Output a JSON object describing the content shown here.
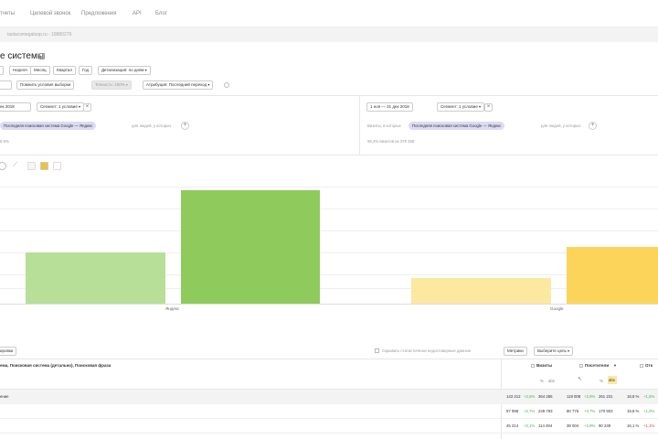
{
  "nav": {
    "items": [
      "тчеты",
      "Целевой звонок",
      "Предложения",
      "API",
      "Блог"
    ]
  },
  "breadcrumb": "tastacsmegaloop.ru - 18880279",
  "page": {
    "title": "е системы"
  },
  "toolbar": {
    "period_buttons": [
      "",
      "Неделя",
      "Месяц",
      "Квартал",
      "Год"
    ],
    "detail": "Детализация: по дням",
    "row2": [
      "",
      "Помнить условия выборки",
      "Точность: 100%",
      "Атрибуция: Последний переход"
    ]
  },
  "segments": {
    "left": {
      "date": "ек 2018",
      "filter": "Сегмент: 1 условие",
      "tag": "Последняя поисковая система Google — Яндекс",
      "more": "для людей, у которых",
      "visits": "8.9%"
    },
    "right": {
      "date": "1 ноя — 31 дек 2018",
      "filter": "Сегмент: 1 условие",
      "prefix": "Визиты, в которых",
      "tag": "Последняя поисковая система Google — Яндекс",
      "more": "для людей, у которых",
      "visits": "98,4% визитов из 378 285"
    }
  },
  "chart_data": {
    "type": "bar",
    "categories": [
      "Яндекс",
      "Google"
    ],
    "series": [
      {
        "values": [
          28,
          62
        ]
      },
      {
        "values": [
          14,
          31
        ]
      }
    ],
    "colors": {
      "yandex_light": "#b7df97",
      "yandex_dark": "#8fcb5c",
      "google_light": "#fde8a0",
      "google_dark": "#fdd45a"
    },
    "grid": true
  },
  "table": {
    "group_button": "ировки",
    "hide_unreliable": "Скрывать статистически недостоверные данные",
    "metrics_button": "Метрики",
    "goal_button": "Выберите цель",
    "dimension_header": "ема, Поисковая система (детально), Поисковая фраза",
    "col_visits": "Визиты",
    "col_users": "Посетители",
    "col_extra": "Отк",
    "unit_pct": "%",
    "unit_abs": "abs",
    "total_label": "ение",
    "rows": [
      {
        "a": "143 212",
        "a_d": "+2,5%",
        "b": "364 286",
        "c": "119 008",
        "c_d": "+2,8%",
        "d": "261 231",
        "e": "18,8 %",
        "e_d": "+1,5%"
      },
      {
        "a": "97 998",
        "a_d": "+2,7%",
        "b": "249 793",
        "c": "80 776",
        "c_d": "+3,7%",
        "d": "170 903",
        "e": "19,8 %",
        "e_d": "+1,0%"
      },
      {
        "a": "45 214",
        "a_d": "+2,1%",
        "b": "114 494",
        "c": "38 004",
        "c_d": "+2,8%",
        "d": "90 249",
        "e": "16,1 %",
        "e_d": "+1,1%"
      }
    ]
  }
}
